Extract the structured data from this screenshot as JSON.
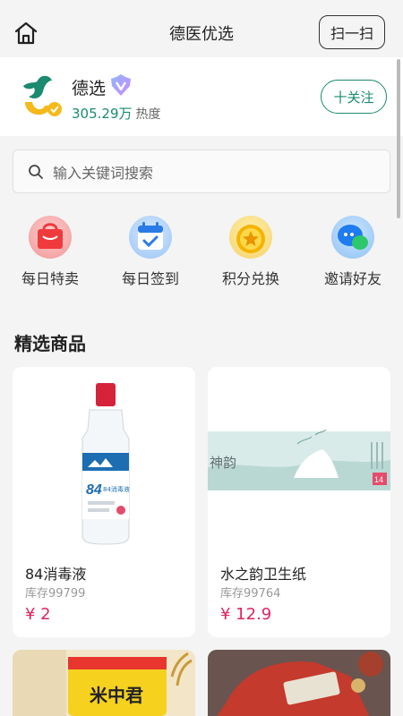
{
  "header": {
    "title": "德医优选",
    "scan_label": "扫一扫",
    "home_icon": "home-icon"
  },
  "store": {
    "name": "德选",
    "heat_value": "305.29万",
    "heat_label": "热度",
    "follow_label": "十关注",
    "brand_color": "#1a8a70"
  },
  "search": {
    "placeholder": "输入关键词搜索"
  },
  "quick_actions": [
    {
      "label": "每日特卖",
      "icon": "mall-bag-icon"
    },
    {
      "label": "每日签到",
      "icon": "calendar-check-icon"
    },
    {
      "label": "积分兑换",
      "icon": "star-coin-icon"
    },
    {
      "label": "邀请好友",
      "icon": "chat-friends-icon"
    }
  ],
  "section": {
    "title": "精选商品"
  },
  "products": [
    {
      "name": "84消毒液",
      "stock": "库存99799",
      "price": "¥ 2",
      "bottle_label": "84消毒液"
    },
    {
      "name": "水之韵卫生纸",
      "stock": "库存99764",
      "price": "¥ 12.9",
      "pack_label": "神韵"
    },
    {
      "name": "",
      "stock": "",
      "price": "",
      "bag_label": "米中君"
    },
    {
      "name": "",
      "stock": "",
      "price": ""
    }
  ],
  "price_color": "#e0245e"
}
